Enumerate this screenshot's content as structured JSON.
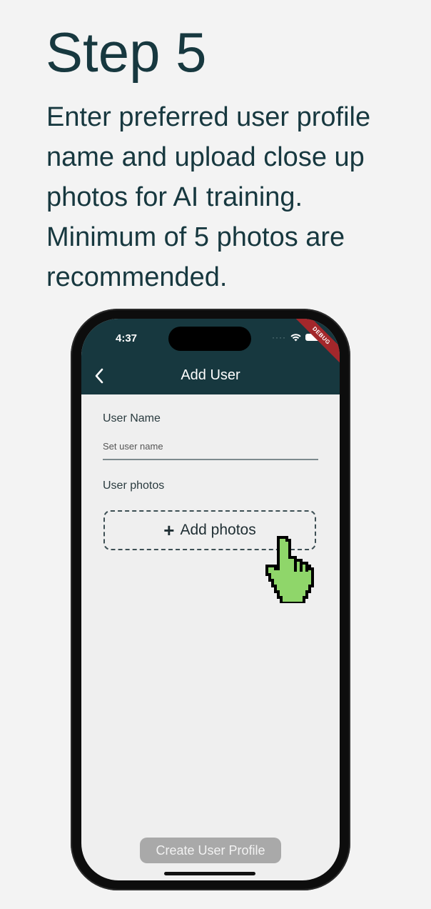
{
  "heading": {
    "title": "Step 5",
    "description": "Enter preferred user profile name and upload close up photos for AI training. Minimum of 5 photos are recommended."
  },
  "status_bar": {
    "time": "4:37",
    "debug_label": "DEBUG",
    "icons": [
      "cellular-icon",
      "wifi-icon",
      "battery-icon"
    ]
  },
  "appbar": {
    "back_icon": "chevron-left-icon",
    "title": "Add User"
  },
  "form": {
    "user_name_label": "User Name",
    "user_name_placeholder": "Set user name",
    "user_name_value": "",
    "photos_label": "User photos",
    "add_photos_label": "Add photos",
    "submit_label": "Create User Profile"
  },
  "colors": {
    "appbar": "#17383f",
    "heading_text": "#17383f",
    "disabled_button": "#a9a9a9",
    "debug_banner": "#a3272b",
    "cursor_fill": "#8fd66a"
  }
}
